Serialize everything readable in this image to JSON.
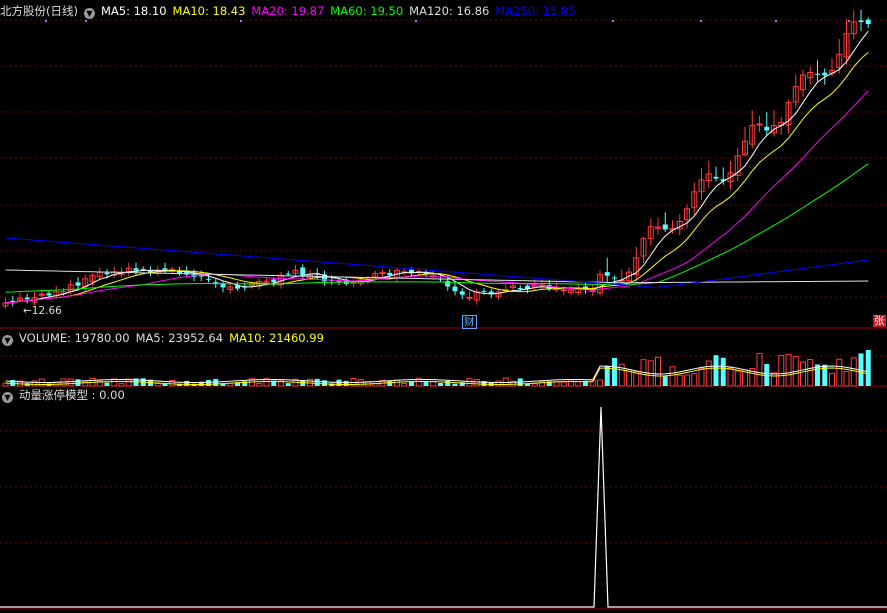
{
  "price_header": {
    "title": "北方股份(日线)",
    "items": [
      {
        "text": "MA5: 18.10",
        "color": "#ffffff"
      },
      {
        "text": "MA10: 18.43",
        "color": "#ffff00"
      },
      {
        "text": "MA20: 19.87",
        "color": "#ff00ff"
      },
      {
        "text": "MA60: 19.50",
        "color": "#00ff00"
      },
      {
        "text": "MA120: 16.86",
        "color": "#dddddd"
      },
      {
        "text": "MA250: 15.85",
        "color": "#0000ff"
      }
    ]
  },
  "volume_header": {
    "items": [
      {
        "text": "VOLUME: 19780.00",
        "color": "#dddddd"
      },
      {
        "text": "MA5: 23952.64",
        "color": "#dddddd"
      },
      {
        "text": "MA10: 21460.99",
        "color": "#ffff00"
      }
    ]
  },
  "indicator_header": {
    "text": "动量涨停模型 : 0.00",
    "color": "#dddddd"
  },
  "annotations": {
    "low_marker": "←12.66",
    "event_cai": "财",
    "event_zhang": "张"
  },
  "chart_data": {
    "type": "candlestick",
    "colors": {
      "up": "#ff3b3b",
      "down": "#54ffff",
      "grid": "#7a0000"
    },
    "low_label_value": 12.66,
    "volume_series_names": [
      "VOLUME",
      "MA5",
      "MA10"
    ],
    "indicator": {
      "name": "动量涨停模型",
      "value": 0.0,
      "spike_close": 1
    }
  }
}
